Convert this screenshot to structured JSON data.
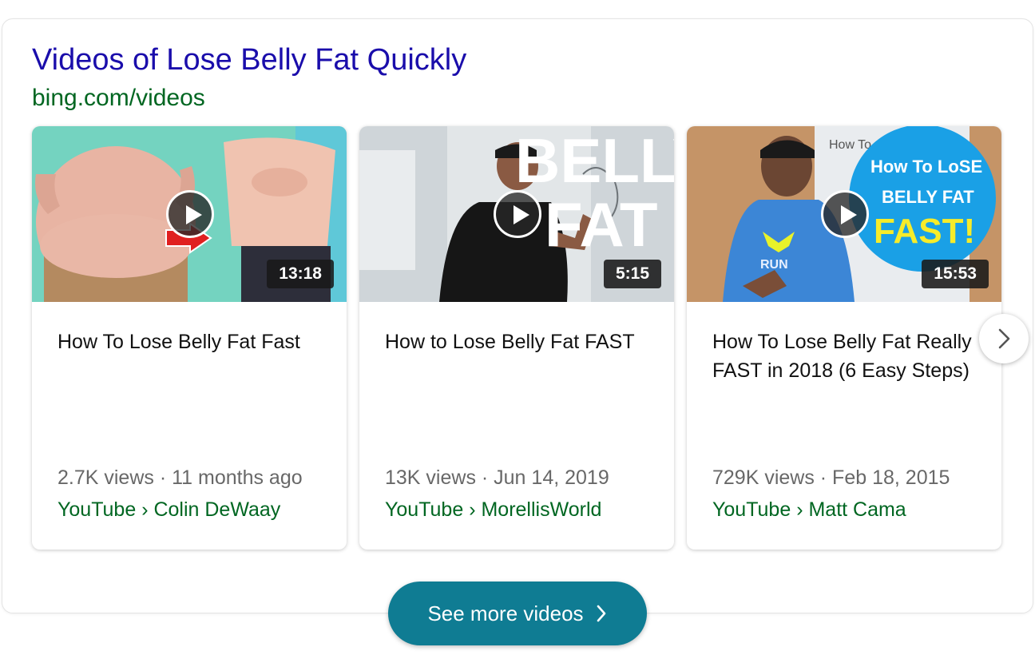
{
  "header": {
    "title": "Videos of Lose Belly Fat Quickly",
    "source": "bing.com/videos"
  },
  "videos": [
    {
      "title": "How To Lose Belly Fat Fast",
      "duration": "13:18",
      "meta": "2.7K views · 11 months ago",
      "channel": "YouTube › Colin DeWaay"
    },
    {
      "title": "How to Lose Belly Fat FAST",
      "duration": "5:15",
      "meta": "13K views · Jun 14, 2019",
      "channel": "YouTube › MorellisWorld",
      "thumb_text": [
        "BELLY",
        "FAT"
      ]
    },
    {
      "title": "How To Lose Belly Fat Really FAST in 2018 (6 Easy Steps)",
      "duration": "15:53",
      "meta": "729K views · Feb 18, 2015",
      "channel": "YouTube › Matt Cama",
      "thumb_text": [
        "How To LoSE",
        "BELLY FAT",
        "FAST!",
        "How To",
        "RUN"
      ]
    }
  ],
  "carousel": {
    "next_icon": "chevron-right-icon"
  },
  "footer": {
    "see_more_label": "See more videos",
    "see_more_icon": "chevron-right-icon"
  },
  "colors": {
    "title_link": "#1a0dab",
    "source_green": "#006621",
    "button_teal": "#0f7c93"
  }
}
